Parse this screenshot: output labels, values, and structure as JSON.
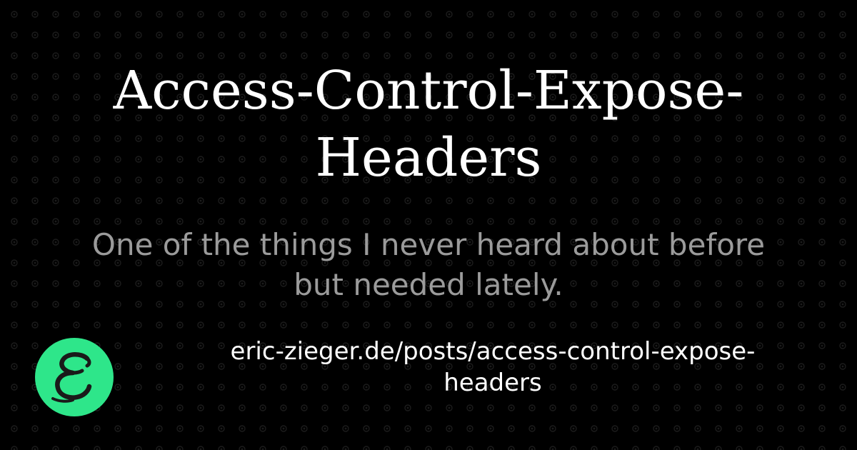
{
  "card": {
    "title_lines": [
      "Access-Control-Expose-",
      "Headers"
    ],
    "subtitle_lines": [
      "One of the things I never heard about before",
      "but needed lately."
    ],
    "url_lines": [
      "eric-zieger.de/posts/access-control-expose-",
      "headers"
    ],
    "logo": {
      "icon": "script-e-logo-icon",
      "letter": "E",
      "circle_color": "#2ee68a",
      "letter_color": "#1a1a1a"
    }
  },
  "colors": {
    "background": "#000000",
    "title": "#ffffff",
    "subtitle": "#9b9b9b",
    "url": "#ffffff",
    "pattern_dot": "#1c1c1c"
  }
}
